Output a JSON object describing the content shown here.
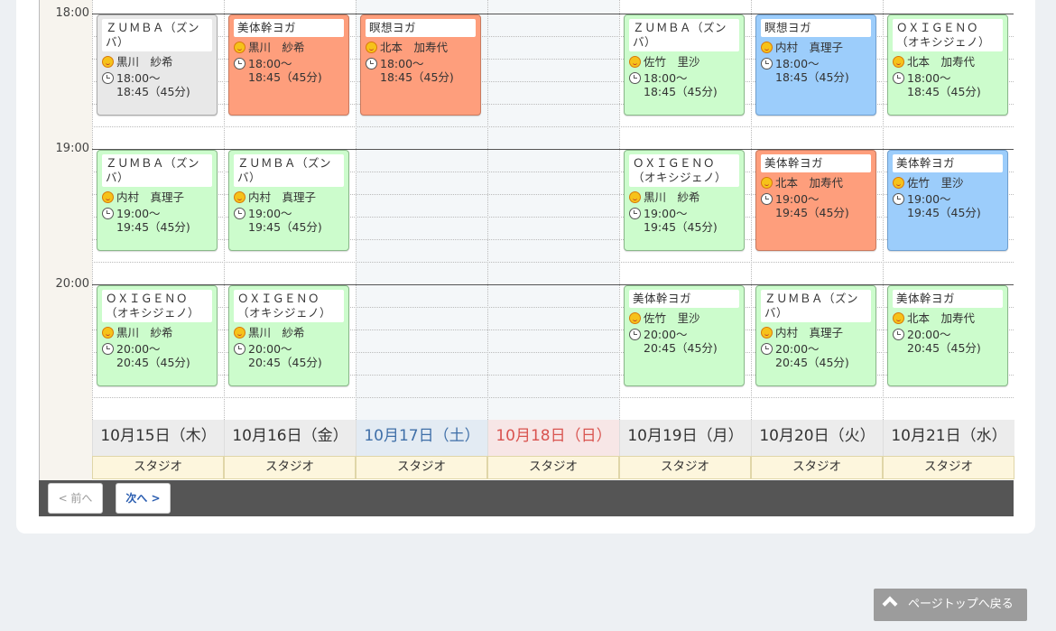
{
  "time_slots": [
    "18:00",
    "19:00",
    "20:00"
  ],
  "days": [
    {
      "date": "10月15日（木）",
      "studio": "スタジオ",
      "kind": "weekday"
    },
    {
      "date": "10月16日（金）",
      "studio": "スタジオ",
      "kind": "weekday"
    },
    {
      "date": "10月17日（土）",
      "studio": "スタジオ",
      "kind": "sat"
    },
    {
      "date": "10月18日（日）",
      "studio": "スタジオ",
      "kind": "sun"
    },
    {
      "date": "10月19日（月）",
      "studio": "スタジオ",
      "kind": "weekday"
    },
    {
      "date": "10月20日（火）",
      "studio": "スタジオ",
      "kind": "weekday"
    },
    {
      "date": "10月21日（水）",
      "studio": "スタジオ",
      "kind": "weekday"
    }
  ],
  "events": [
    {
      "day": 0,
      "slot": 0,
      "color": "gray",
      "title": "ＺＵＭＢＡ（ズンバ）",
      "instructor": "黒川　紗希",
      "time1": "18:00～",
      "time2": "18:45（45分)"
    },
    {
      "day": 1,
      "slot": 0,
      "color": "orange",
      "title": "美体幹ヨガ",
      "instructor": "黒川　紗希",
      "time1": "18:00～",
      "time2": "18:45（45分)"
    },
    {
      "day": 2,
      "slot": 0,
      "color": "orange",
      "title": "瞑想ヨガ",
      "instructor": "北本　加寿代",
      "time1": "18:00～",
      "time2": "18:45（45分)"
    },
    {
      "day": 4,
      "slot": 0,
      "color": "green",
      "title": "ＺＵＭＢＡ（ズンバ）",
      "instructor": "佐竹　里沙",
      "time1": "18:00～",
      "time2": "18:45（45分)"
    },
    {
      "day": 5,
      "slot": 0,
      "color": "blue",
      "title": "瞑想ヨガ",
      "instructor": "内村　真理子",
      "time1": "18:00～",
      "time2": "18:45（45分)"
    },
    {
      "day": 6,
      "slot": 0,
      "color": "green",
      "title": "ＯＸＩＧＥＮＯ（オキシジェノ）",
      "instructor": "北本　加寿代",
      "time1": "18:00～",
      "time2": "18:45（45分)"
    },
    {
      "day": 0,
      "slot": 1,
      "color": "green",
      "title": "ＺＵＭＢＡ（ズンバ）",
      "instructor": "内村　真理子",
      "time1": "19:00～",
      "time2": "19:45（45分)"
    },
    {
      "day": 1,
      "slot": 1,
      "color": "green",
      "title": "ＺＵＭＢＡ（ズンバ）",
      "instructor": "内村　真理子",
      "time1": "19:00～",
      "time2": "19:45（45分)"
    },
    {
      "day": 4,
      "slot": 1,
      "color": "green",
      "title": "ＯＸＩＧＥＮＯ（オキシジェノ）",
      "instructor": "黒川　紗希",
      "time1": "19:00～",
      "time2": "19:45（45分)"
    },
    {
      "day": 5,
      "slot": 1,
      "color": "orange",
      "title": "美体幹ヨガ",
      "instructor": "北本　加寿代",
      "time1": "19:00～",
      "time2": "19:45（45分)"
    },
    {
      "day": 6,
      "slot": 1,
      "color": "blue",
      "title": "美体幹ヨガ",
      "instructor": "佐竹　里沙",
      "time1": "19:00～",
      "time2": "19:45（45分)"
    },
    {
      "day": 0,
      "slot": 2,
      "color": "green",
      "title": "ＯＸＩＧＥＮＯ（オキシジェノ）",
      "instructor": "黒川　紗希",
      "time1": "20:00～",
      "time2": "20:45（45分)"
    },
    {
      "day": 1,
      "slot": 2,
      "color": "green",
      "title": "ＯＸＩＧＥＮＯ（オキシジェノ）",
      "instructor": "黒川　紗希",
      "time1": "20:00～",
      "time2": "20:45（45分)"
    },
    {
      "day": 4,
      "slot": 2,
      "color": "green",
      "title": "美体幹ヨガ",
      "instructor": "佐竹　里沙",
      "time1": "20:00～",
      "time2": "20:45（45分)"
    },
    {
      "day": 5,
      "slot": 2,
      "color": "green",
      "title": "ＺＵＭＢＡ（ズンバ）",
      "instructor": "内村　真理子",
      "time1": "20:00～",
      "time2": "20:45（45分)"
    },
    {
      "day": 6,
      "slot": 2,
      "color": "green",
      "title": "美体幹ヨガ",
      "instructor": "北本　加寿代",
      "time1": "20:00～",
      "time2": "20:45（45分)"
    }
  ],
  "nav": {
    "prev": "< 前へ",
    "next": "次へ >"
  },
  "page_top": "ページトップへ戻る",
  "colors": {
    "green": "#ccfccc",
    "orange": "#fe9e7c",
    "blue": "#9ccdfb",
    "gray": "#e8e8e8",
    "footer": "#555555"
  }
}
